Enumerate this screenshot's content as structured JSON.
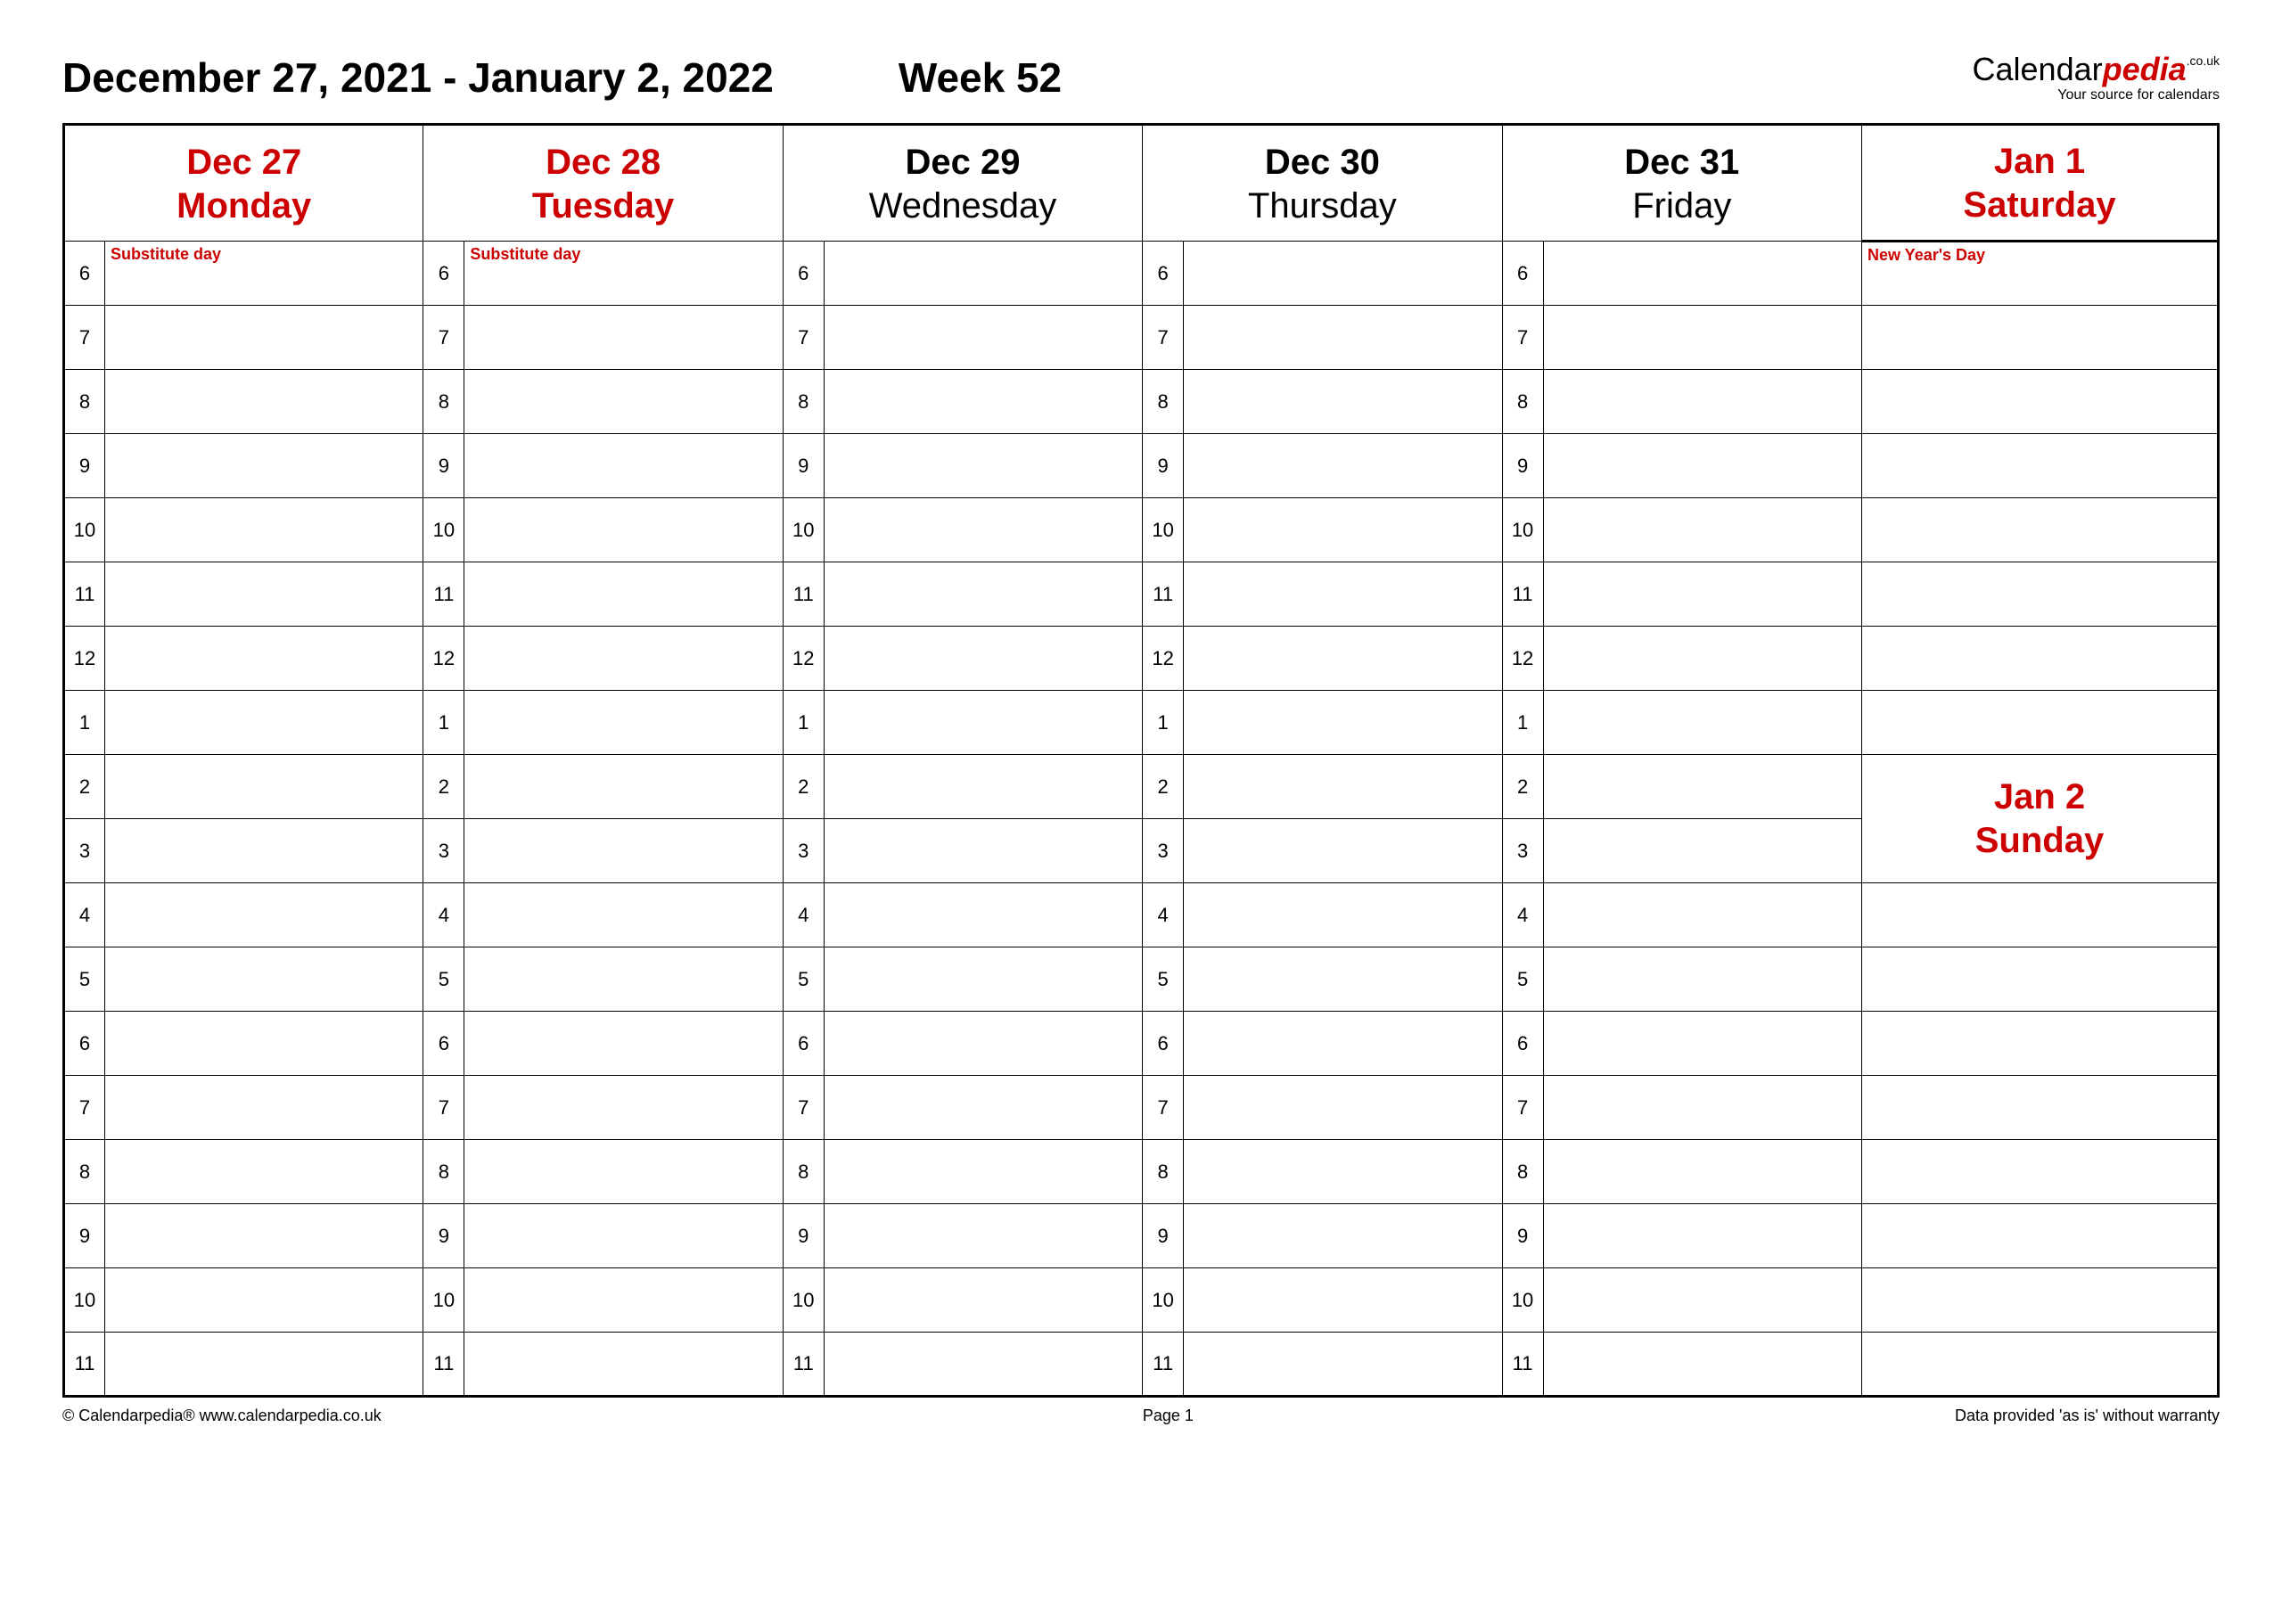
{
  "header": {
    "date_range": "December 27, 2021 - January 2, 2022",
    "week_label": "Week 52",
    "brand_prefix": "Calendar",
    "brand_suffix": "pedia",
    "brand_tld": ".co.uk",
    "brand_tagline": "Your source for calendars"
  },
  "days": [
    {
      "date": "Dec 27",
      "dow": "Monday",
      "red": true,
      "note": "Substitute day"
    },
    {
      "date": "Dec 28",
      "dow": "Tuesday",
      "red": true,
      "note": "Substitute day"
    },
    {
      "date": "Dec 29",
      "dow": "Wednesday",
      "red": false,
      "note": ""
    },
    {
      "date": "Dec 30",
      "dow": "Thursday",
      "red": false,
      "note": ""
    },
    {
      "date": "Dec 31",
      "dow": "Friday",
      "red": false,
      "note": ""
    }
  ],
  "weekend": {
    "sat": {
      "date": "Jan 1",
      "dow": "Saturday",
      "note": "New Year's Day"
    },
    "sun": {
      "date": "Jan 2",
      "dow": "Sunday"
    }
  },
  "hours": [
    "6",
    "7",
    "8",
    "9",
    "10",
    "11",
    "12",
    "1",
    "2",
    "3",
    "4",
    "5",
    "6",
    "7",
    "8",
    "9",
    "10",
    "11"
  ],
  "footer": {
    "left": "© Calendarpedia®   www.calendarpedia.co.uk",
    "center": "Page 1",
    "right": "Data provided 'as is' without warranty"
  }
}
